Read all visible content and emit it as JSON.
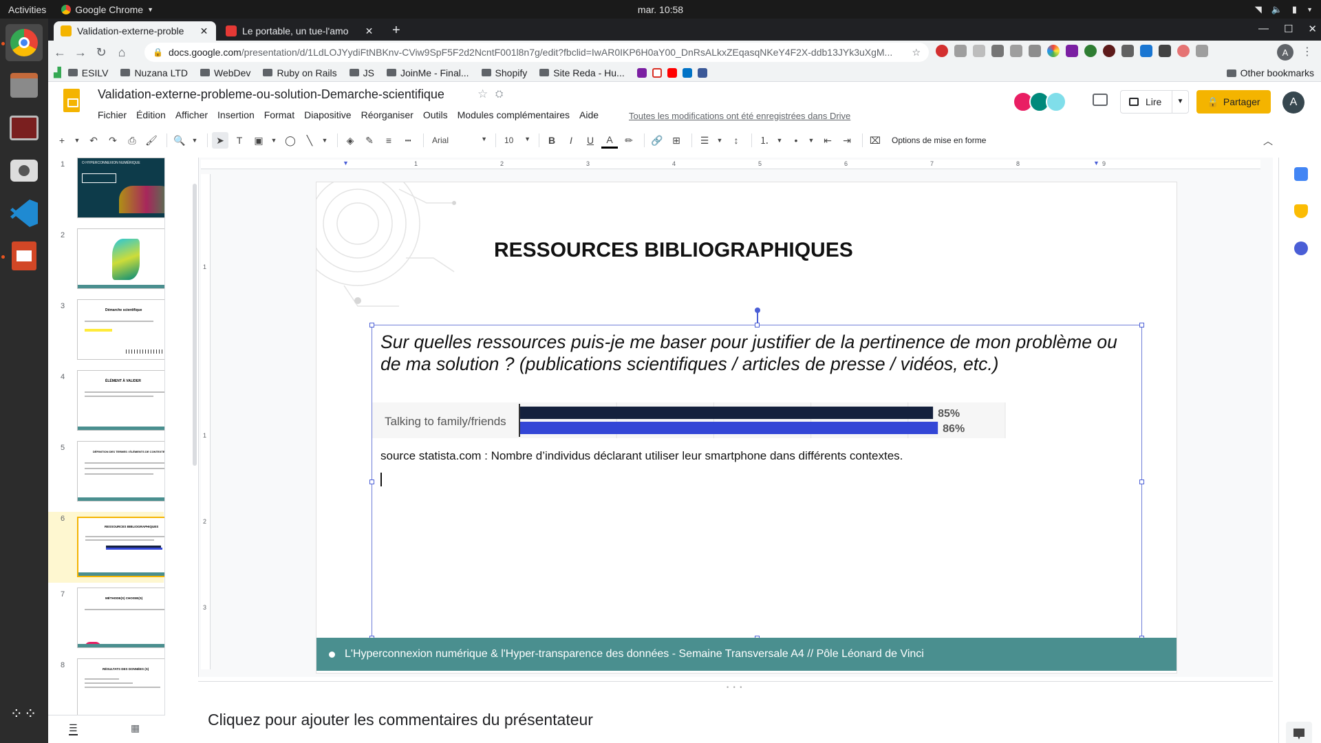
{
  "gnome": {
    "activities": "Activities",
    "app_name": "Google Chrome",
    "clock": "mar. 10:58"
  },
  "chrome": {
    "tabs": [
      {
        "label": "Validation-externe-proble",
        "active": true
      },
      {
        "label": "Le portable, un tue-l'amo",
        "active": false
      }
    ],
    "url_host": "docs.google.com",
    "url_path": "/presentation/d/1LdLOJYydiFtNBKnv-CViw9SpF5F2d2NcntF001l8n7g/edit?fbclid=IwAR0IKP6H0aY00_DnRsALkxZEqasqNKeY4F2X-ddb13JYk3uXgM...",
    "profile_initial": "A",
    "bookmarks": [
      {
        "label": "ESILV"
      },
      {
        "label": "Nuzana LTD"
      },
      {
        "label": "WebDev"
      },
      {
        "label": "Ruby on Rails"
      },
      {
        "label": "JS"
      },
      {
        "label": "JoinMe - Final..."
      },
      {
        "label": "Shopify"
      },
      {
        "label": "Site Reda - Hu..."
      }
    ],
    "other_bookmarks": "Other bookmarks"
  },
  "slides": {
    "doc_title": "Validation-externe-probleme-ou-solution-Demarche-scientifique",
    "menu": [
      "Fichier",
      "Édition",
      "Afficher",
      "Insertion",
      "Format",
      "Diapositive",
      "Réorganiser",
      "Outils",
      "Modules complémentaires",
      "Aide"
    ],
    "saved_note": "Toutes les modifications ont été enregistrées dans Drive",
    "lire_label": "Lire",
    "share_label": "Partager",
    "user_initial": "A",
    "toolbar": {
      "font": "Arial",
      "size": "10",
      "options_label": "Options de mise en forme"
    },
    "ruler_h": [
      "1",
      "2",
      "3",
      "4",
      "5",
      "6",
      "7",
      "8",
      "9"
    ],
    "ruler_v": [
      "1",
      "1",
      "2",
      "3"
    ],
    "thumbnails": [
      {
        "num": "1",
        "title": "O HYPERCONNEXION NUMÉRIQUE"
      },
      {
        "num": "2",
        "title": ""
      },
      {
        "num": "3",
        "title": "Démarche scientifique"
      },
      {
        "num": "4",
        "title": "ÉLÉMENT À VALIDER"
      },
      {
        "num": "5",
        "title": "DÉFINITION DES TERMES / ÉLÉMENTS DE CONTEXTE"
      },
      {
        "num": "6",
        "title": "RESSOURCES BIBLIOGRAPHIQUES"
      },
      {
        "num": "7",
        "title": "MÉTHODE(S) CHOISIE(S)"
      },
      {
        "num": "8",
        "title": "RÉSULTATS DES DONNÉES (S)"
      }
    ],
    "selected_slide": 6,
    "slide": {
      "title": "RESSOURCES BIBLIOGRAPHIQUES",
      "question": "Sur quelles ressources puis-je me baser pour justifier de la pertinence de mon problème ou de ma solution ? (publications scientifiques / articles de presse / vidéos, etc.)",
      "source": "source statista.com : Nombre d’individus déclarant utiliser leur smartphone dans différents contextes.",
      "footer": "L'Hyperconnexion numérique & l'Hyper-transparence des données - Semaine Transversale A4 // Pôle Léonard de Vinci"
    },
    "notes_placeholder": "Cliquez pour ajouter les commentaires du présentateur"
  },
  "chart_data": {
    "type": "bar",
    "orientation": "horizontal",
    "categories": [
      "Talking to family/friends"
    ],
    "series": [
      {
        "values": [
          85
        ],
        "color": "#14213d"
      },
      {
        "values": [
          86
        ],
        "color": "#3346d6"
      }
    ],
    "data_labels": [
      "85%",
      "86%"
    ],
    "xlim": [
      0,
      100
    ],
    "grid": true
  },
  "colors": {
    "slides_yellow": "#f4b400",
    "footer_teal": "#4a8f8f",
    "selection_blue": "#4a5ed6"
  }
}
